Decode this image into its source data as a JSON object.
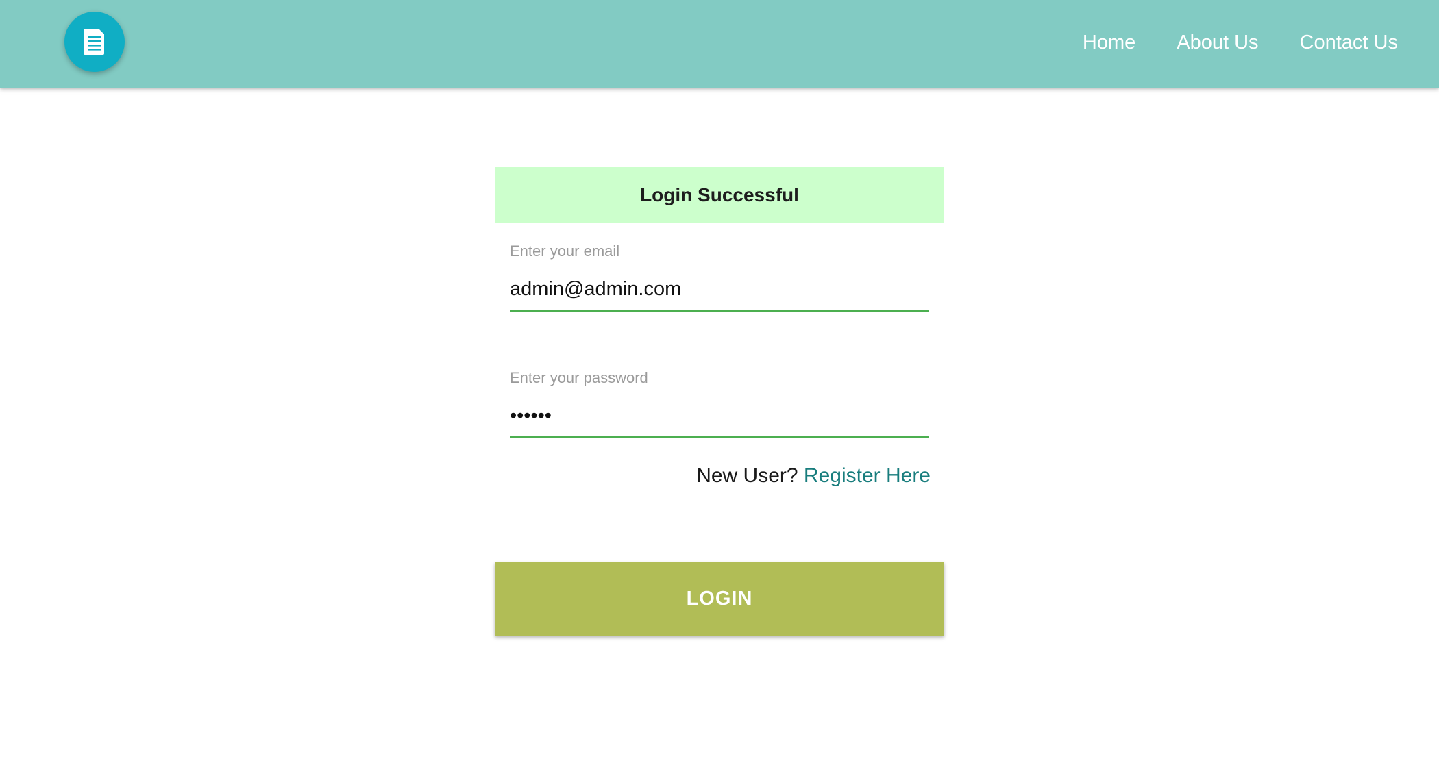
{
  "colors": {
    "navbar_bg": "#82cbc3",
    "logo_bg": "#10aec4",
    "alert_bg": "#ccffcc",
    "input_underline": "#4caf50",
    "link": "#187d7d",
    "login_button_bg": "#b1bd56"
  },
  "header": {
    "logo_icon": "document-icon",
    "nav": [
      {
        "label": "Home"
      },
      {
        "label": "About Us"
      },
      {
        "label": "Contact Us"
      }
    ]
  },
  "login": {
    "alert_text": "Login Successful",
    "email": {
      "label": "Enter your email",
      "value": "admin@admin.com"
    },
    "password": {
      "label": "Enter your password",
      "value": "••••••"
    },
    "register_prompt": "New User?",
    "register_link": "Register Here",
    "submit_label": "LOGIN"
  }
}
